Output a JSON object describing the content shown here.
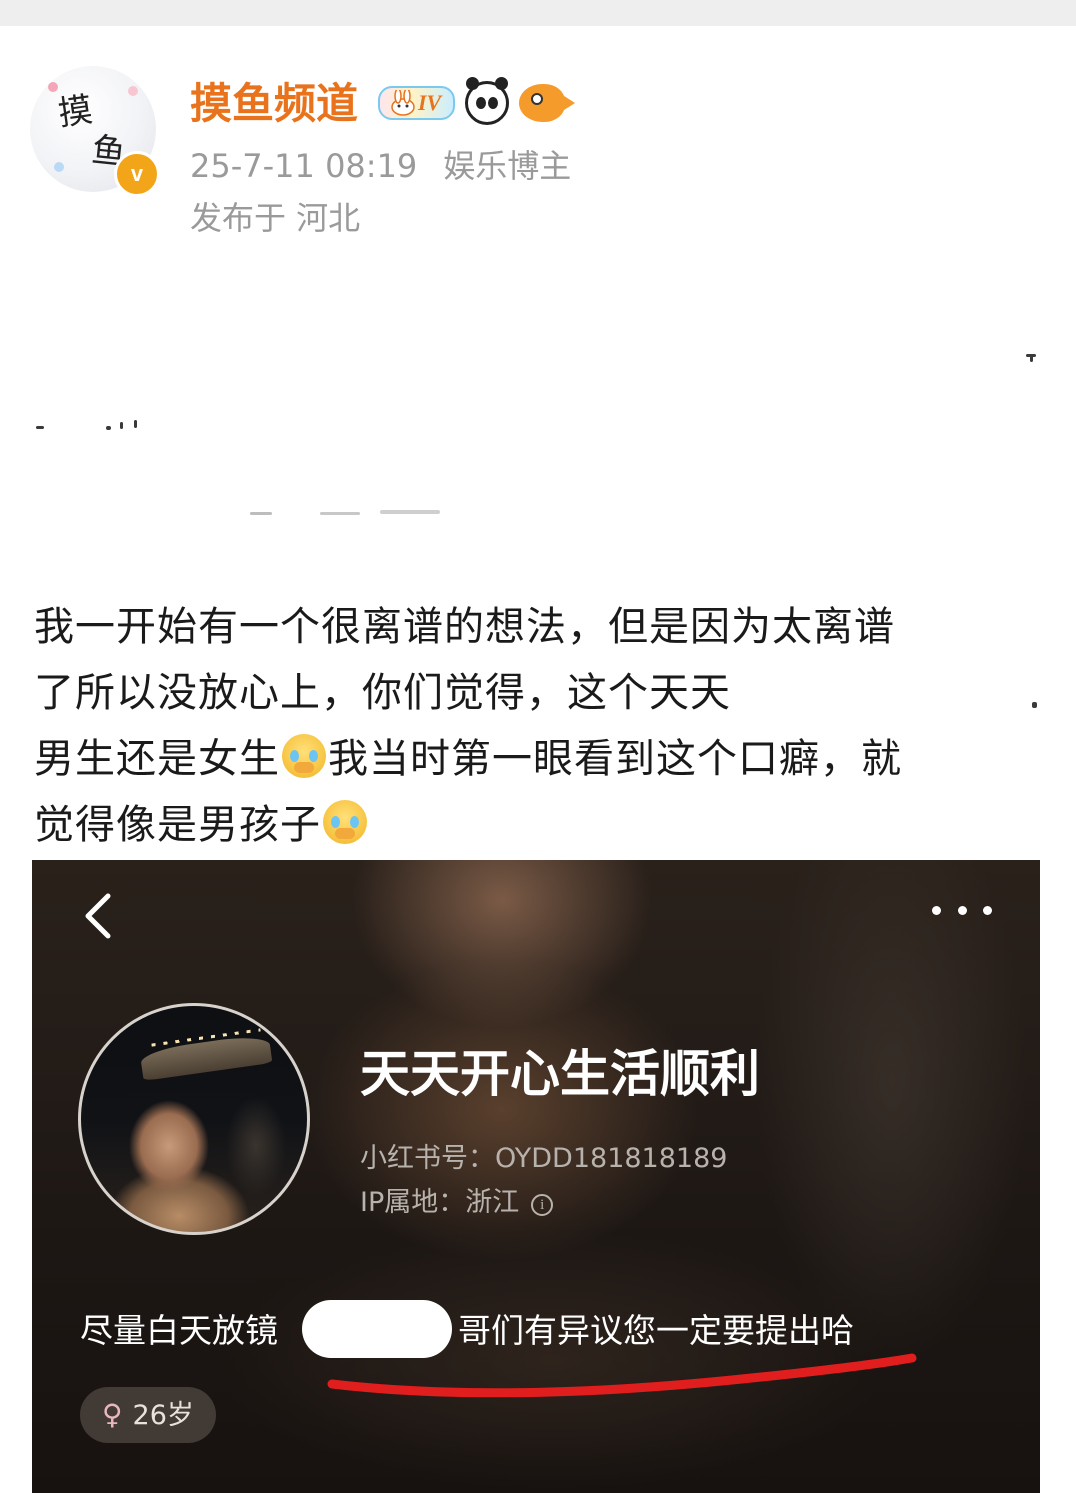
{
  "post": {
    "author": {
      "name": "摸鱼频道",
      "avatar_text_1": "摸",
      "avatar_text_2": "鱼",
      "verified_mark": "v",
      "level_badge": "IV",
      "badge_icons": [
        "bunny-level-icon",
        "panda-icon",
        "goldfish-icon"
      ]
    },
    "meta": {
      "time": "25-7-11 08:19",
      "category": "娱乐博主",
      "location": "发布于 河北"
    },
    "text_lines": [
      {
        "text": "我一开始有一个很离谱的想法，但是因为太离谱"
      },
      {
        "text": "了所以没放心上，你们觉得，这个天天"
      },
      {
        "before": "男生还是女生",
        "after": "我当时第一眼看到这个口癖，就"
      },
      {
        "before": "觉得像是男孩子"
      }
    ],
    "emoji_name": "tearful-emoji"
  },
  "screenshot": {
    "profile_name": "天天开心生活顺利",
    "profile_id": "小红书号：OYDD181818189",
    "ip_location": "IP属地：浙江",
    "bio_start": "尽量白天放镜",
    "bio_end": "哥们有异议您一定要提出哈",
    "age": "26岁",
    "annotation_color": "#e01e1e"
  },
  "colors": {
    "username": "#e8731c",
    "meta": "#9a9a9a",
    "verified_badge": "#f3a51a"
  }
}
